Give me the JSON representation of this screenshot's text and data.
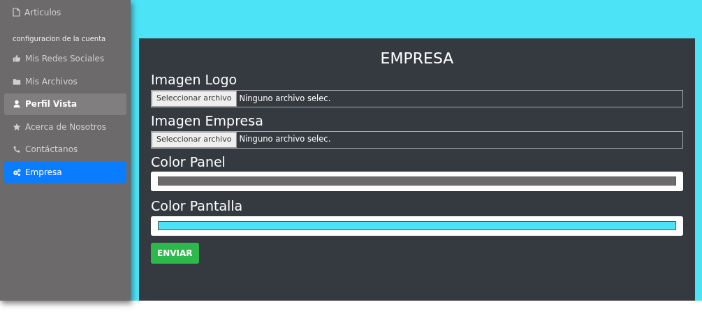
{
  "sidebar": {
    "top_item": {
      "label": "Articulos"
    },
    "section_title": "configuracion de la cuenta",
    "items": [
      {
        "label": "Mis Redes Sociales",
        "selected": false,
        "hover": false
      },
      {
        "label": "Mis Archivos",
        "selected": false,
        "hover": false
      },
      {
        "label": "Perfil Vista",
        "selected": false,
        "hover": true
      },
      {
        "label": "Acerca de Nosotros",
        "selected": false,
        "hover": false
      },
      {
        "label": "Contáctanos",
        "selected": false,
        "hover": false
      },
      {
        "label": "Empresa",
        "selected": true,
        "hover": false
      }
    ]
  },
  "form": {
    "title": "EMPRESA",
    "fields": [
      {
        "kind": "file",
        "label": "Imagen Logo",
        "button": "Seleccionar archivo",
        "value": "Ninguno archivo selec."
      },
      {
        "kind": "file",
        "label": "Imagen Empresa",
        "button": "Seleccionar archivo",
        "value": "Ninguno archivo selec."
      },
      {
        "kind": "color",
        "label": "Color Panel",
        "color": "#6c6a6a"
      },
      {
        "kind": "color",
        "label": "Color Pantalla",
        "color": "#4de3f7"
      }
    ],
    "submit": "ENVIAR"
  }
}
